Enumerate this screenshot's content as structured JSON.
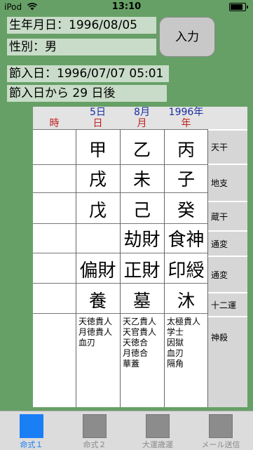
{
  "status": {
    "carrier": "iPod",
    "time": "13:10"
  },
  "info": {
    "birth": "生年月日：1996/08/05",
    "sex": "性別：男",
    "setsu": "節入日：1996/07/07 05:01",
    "after": "節入日から 29 日後"
  },
  "input_button": "入力",
  "header": {
    "dates": [
      "5日",
      "8月",
      "1996年"
    ],
    "labels": [
      "時",
      "日",
      "月",
      "年"
    ]
  },
  "rows": {
    "tenkan": {
      "values": [
        "",
        "甲",
        "乙",
        "丙"
      ],
      "label": "天干"
    },
    "chishi": {
      "values": [
        "",
        "戌",
        "未",
        "子"
      ],
      "label": "地支"
    },
    "zoukan": {
      "values": [
        "",
        "戊",
        "己",
        "癸"
      ],
      "label": "蔵干"
    },
    "tsuhen1": {
      "values": [
        "",
        "",
        "劫財",
        "食神"
      ],
      "label": "通変"
    },
    "tsuhen2": {
      "values": [
        "",
        "偏財",
        "正財",
        "印綬"
      ],
      "label": "通変"
    },
    "juniun": {
      "values": [
        "",
        "養",
        "墓",
        "沐"
      ],
      "label": "十二運"
    },
    "shinsatsu": {
      "values": [
        "",
        "天徳貴人\n月徳貴人\n血刃",
        "天乙貴人\n天官貴人\n天徳合\n月徳合\n華蓋",
        "太極貴人\n学士\n因獄\n血刃\n隔角"
      ],
      "label": "神殺"
    }
  },
  "tabs": [
    "命式１",
    "命式２",
    "大運歳運",
    "メール送信"
  ]
}
